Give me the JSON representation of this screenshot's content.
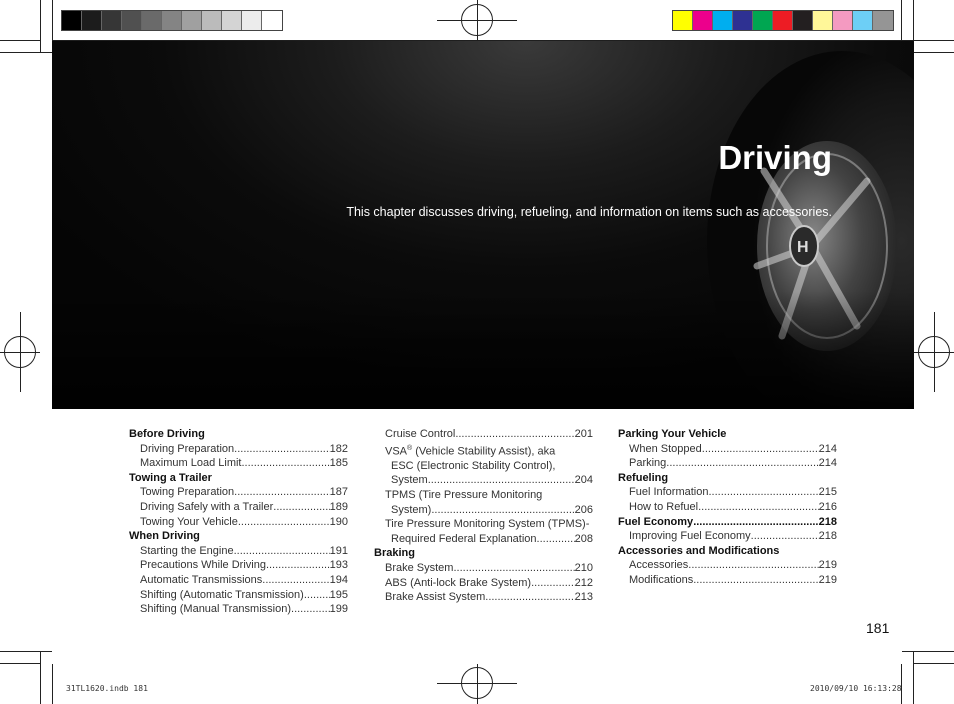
{
  "color_bars": {
    "gray": [
      "#000000",
      "#1c1c1c",
      "#363636",
      "#505050",
      "#6a6a6a",
      "#848484",
      "#a0a0a0",
      "#bbbbbb",
      "#d4d4d4",
      "#ececec",
      "#ffffff"
    ],
    "color": [
      "#ffff00",
      "#ec008c",
      "#00aeef",
      "#2e3192",
      "#00a651",
      "#ed1c24",
      "#231f20",
      "#fff799",
      "#f49ac1",
      "#6dcff6",
      "#959595"
    ]
  },
  "chapter": {
    "title": "Driving",
    "intro": "This chapter discusses driving, refueling, and information on items such as accessories."
  },
  "toc": {
    "col1": {
      "before_driving": {
        "heading": "Before Driving",
        "items": [
          {
            "label": "Driving Preparation",
            "page": "182"
          },
          {
            "label": "Maximum Load Limit",
            "page": "185"
          }
        ]
      },
      "towing": {
        "heading": "Towing a Trailer",
        "items": [
          {
            "label": "Towing Preparation",
            "page": "187"
          },
          {
            "label": "Driving Safely with a Trailer",
            "page": "189"
          },
          {
            "label": "Towing Your Vehicle",
            "page": "190"
          }
        ]
      },
      "when_driving": {
        "heading": "When Driving",
        "items": [
          {
            "label": "Starting the Engine",
            "page": "191"
          },
          {
            "label": "Precautions While Driving",
            "page": "193"
          },
          {
            "label": "Automatic Transmissions",
            "page": "194"
          },
          {
            "label": "Shifting (Automatic Transmission)",
            "page": "195"
          },
          {
            "label": "Shifting (Manual Transmission)",
            "page": "199"
          }
        ]
      }
    },
    "col2": {
      "cruise": {
        "label": "Cruise Control",
        "page": "201"
      },
      "vsa": {
        "line1_prefix": "VSA",
        "line1_reg": "®",
        "line1_suffix": " (Vehicle Stability Assist), aka",
        "line2": "ESC (Electronic Stability Control),",
        "line3": "System",
        "page": "204"
      },
      "tpms": {
        "line1": "TPMS (Tire Pressure Monitoring",
        "line2": "System)",
        "page": "206"
      },
      "tpms_fed": {
        "line1": "Tire Pressure Monitoring System (TPMS)-",
        "line2": "Required Federal Explanation",
        "page": "208"
      },
      "braking": {
        "heading": "Braking",
        "items": [
          {
            "label": "Brake System",
            "page": "210"
          },
          {
            "label": "ABS (Anti-lock Brake System)",
            "page": "212"
          },
          {
            "label": "Brake Assist System",
            "page": "213"
          }
        ]
      }
    },
    "col3": {
      "parking": {
        "heading": "Parking Your Vehicle",
        "items": [
          {
            "label": "When Stopped",
            "page": "214"
          },
          {
            "label": "Parking",
            "page": "214"
          }
        ]
      },
      "refueling": {
        "heading": "Refueling",
        "items": [
          {
            "label": "Fuel Information",
            "page": "215"
          },
          {
            "label": "How to Refuel",
            "page": "216"
          }
        ]
      },
      "fuel_economy": {
        "heading": "Fuel Economy",
        "page": "218",
        "items": [
          {
            "label": "Improving Fuel Economy",
            "page": "218"
          }
        ]
      },
      "accessories": {
        "heading": "Accessories and Modifications",
        "items": [
          {
            "label": "Accessories",
            "page": "219"
          },
          {
            "label": "Modifications",
            "page": "219"
          }
        ]
      }
    }
  },
  "page_number": "181",
  "footer": {
    "file": "31TL1620.indb   181",
    "stamp": "2010/09/10   16:13:28"
  }
}
